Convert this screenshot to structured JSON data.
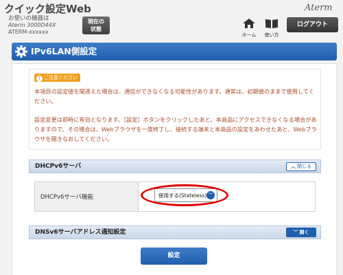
{
  "header": {
    "app_title": "クイック設定Web",
    "device_label": "お使いの機器は",
    "device_model": "Aterm 3000D44X",
    "device_id": "ATERM-xxxxxx",
    "status_button_label": "現在の\n状態",
    "brand_logo": "Aterm",
    "home_label": "ホーム",
    "help_label": "使い方",
    "home_icon": "home-icon",
    "help_icon": "book-icon",
    "logout_label": "ログアウト"
  },
  "page": {
    "title": "IPv6LAN側設定",
    "title_icon": "gear-icon",
    "accent_color": "#1f5fab"
  },
  "notice": {
    "badge_label": "ご注意ください",
    "paragraph_1": "本項目の設定値を間違えた場合は、通信ができなくなる可能性があります。通常は、初期値のままで使用してください。",
    "paragraph_2": "設定変更は即時に有効となります。［設定］ボタンをクリックしたあと、本商品にアクセスできなくなる場合がありますので、その場合は、Webブラウザを一度終了し、接続する端末と本商品の設定をあわせたあと、Webブラウザを開きなおしてください。",
    "text_color": "#a94b2a"
  },
  "dhcp_section": {
    "title": "DHCPv6サーバ",
    "collapse_label": "閉じる",
    "setting_label": "DHCPv6サーバ機能",
    "select_value": "使用する(Stateless)",
    "highlight_color": "#e00000"
  },
  "dns_section": {
    "title": "DNSv6サーバアドレス通知設定",
    "expand_label": "開く"
  },
  "submit_label": "設定"
}
